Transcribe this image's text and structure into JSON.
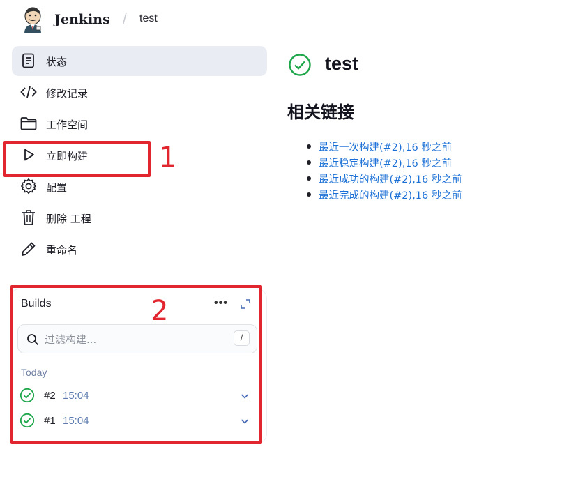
{
  "header": {
    "brand": "Jenkins",
    "separator": "/",
    "breadcrumb": "test"
  },
  "sidebar": {
    "items": [
      {
        "label": "状态",
        "icon": "document-icon",
        "active": true
      },
      {
        "label": "修改记录",
        "icon": "code-icon"
      },
      {
        "label": "工作空间",
        "icon": "folder-icon"
      },
      {
        "label": "立即构建",
        "icon": "play-icon"
      },
      {
        "label": "配置",
        "icon": "gear-icon"
      },
      {
        "label": "删除 工程",
        "icon": "trash-icon"
      },
      {
        "label": "重命名",
        "icon": "pencil-icon"
      }
    ]
  },
  "builds": {
    "title": "Builds",
    "more": "•••",
    "search_placeholder": "过滤构建...",
    "search_shortcut": "/",
    "group": "Today",
    "rows": [
      {
        "number": "#2",
        "time": "15:04",
        "status": "success"
      },
      {
        "number": "#1",
        "time": "15:04",
        "status": "success"
      }
    ]
  },
  "main": {
    "title": "test",
    "related_title": "相关链接",
    "links": [
      "最近一次构建(#2),16 秒之前",
      "最近稳定构建(#2),16 秒之前",
      "最近成功的构建(#2),16 秒之前",
      "最近完成的构建(#2),16 秒之前"
    ]
  },
  "annotations": [
    "1",
    "2"
  ],
  "colors": {
    "accent_red": "#e1262f",
    "success_green": "#1ea64b",
    "link_blue": "#1a6fd6",
    "active_bg": "#e9ecf2"
  }
}
